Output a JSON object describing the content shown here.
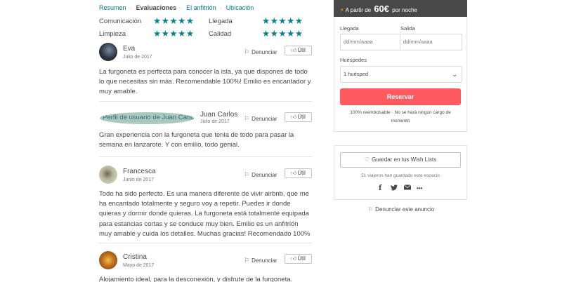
{
  "subnav": {
    "summary": "Resumen",
    "reviews": "Evaluaciones",
    "host": "El anfitrión",
    "location": "Ubicación",
    "separator": "·"
  },
  "ratings": {
    "communication": {
      "label": "Comunicación",
      "stars": 5
    },
    "arrival": {
      "label": "Llegada",
      "stars": 5
    },
    "cleanliness": {
      "label": "Limpieza",
      "stars": 5
    },
    "quality": {
      "label": "Calidad",
      "stars": 5
    },
    "star_glyphs": "★★★★★"
  },
  "actions": {
    "report": "Denunciar",
    "helpful": "Útil"
  },
  "reviews": [
    {
      "name": "Eva",
      "date": "Julio de 2017",
      "text": "La furgoneta es perfecta para conocer la isla, ya que dispones de todo lo que necesitas sin más. Recomendable 100%! Emilio es encantador y muy amable."
    },
    {
      "name": "Juan Carlos",
      "date": "Julio de 2017",
      "alt_text": "Perfil de usuario de Juan Carlos",
      "text": "Gran experiencia con la furgoneta que tenia de todo para pasar la semana en lanzarote. Y con emilio, todo genial."
    },
    {
      "name": "Francesca",
      "date": "Junio de 2017",
      "text": "Todo ha sido perfecto. Es una manera diferente de vivir airbnb, que me ha encantado totalmente y seguro voy a repetir. Puedes ir donde quieras y dormir donde quieras. La furgoneta está totalmente equipada para estancias cortas y se conduce muy bien. Emilio es un anfitrión muy amable y cuida los detalles. Muchas gracias! Recomendado 100%"
    },
    {
      "name": "Cristina",
      "date": "Mayo de 2017",
      "text": "Alojamiento ideal, para la desconexión, y disfrute de la furgoneta."
    }
  ],
  "booking": {
    "price_prefix": "A partir de",
    "price": "60€",
    "price_suffix": "por noche",
    "checkin_label": "Llegada",
    "checkout_label": "Salida",
    "checkin_placeholder": "dd/mm/aaaa",
    "checkout_placeholder": "dd/mm/aaaa",
    "guests_label": "Huéspedes",
    "guests_value": "1 huésped",
    "reserve_button": "Reservar",
    "refund_note": "100% reembolsable · No se hará ningún cargo de momento"
  },
  "wishlist": {
    "button": "Guardar en tus Wish Lists",
    "count_text": "51 viajeros han guardado este espacio"
  },
  "share": {
    "facebook": "f",
    "more": "•••"
  },
  "report_listing": "Denunciar este anuncio",
  "colors": {
    "accent": "#007a87",
    "stars": "#008489",
    "reserve": "#ff5a5f",
    "header_bg": "#484848"
  }
}
